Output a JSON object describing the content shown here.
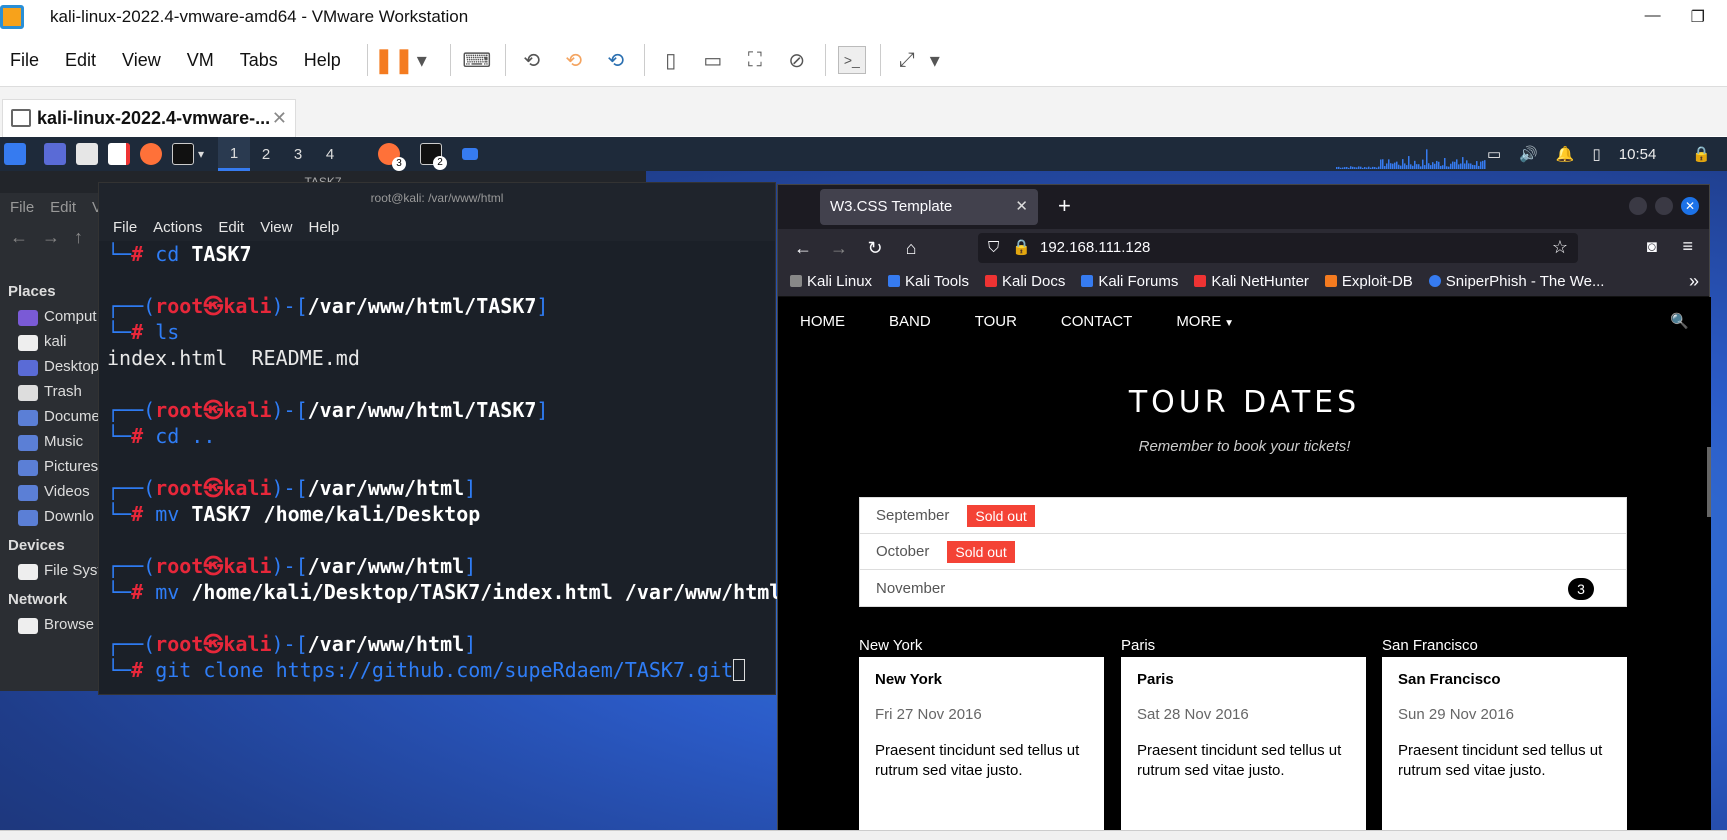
{
  "vmware": {
    "window_title": "kali-linux-2022.4-vmware-amd64 - VMware Workstation",
    "menu": [
      "File",
      "Edit",
      "View",
      "VM",
      "Tabs",
      "Help"
    ],
    "tab_label": "kali-linux-2022.4-vmware-..."
  },
  "panel": {
    "workspaces": [
      "1",
      "2",
      "3",
      "4"
    ],
    "badge_firefox": "3",
    "badge_term": "2",
    "clock": "10:54",
    "graph_color": "#367bf0"
  },
  "filemanager": {
    "title": "TASK7",
    "menu": [
      "File",
      "Edit",
      "V"
    ],
    "places_header": "Places",
    "places": [
      "Comput",
      "kali",
      "Desktop",
      "Trash",
      "Docume",
      "Music",
      "Pictures",
      "Videos",
      "Downlo"
    ],
    "devices_header": "Devices",
    "devices": [
      "File Syst"
    ],
    "network_header": "Network",
    "network": [
      "Browse"
    ]
  },
  "terminal": {
    "title": "root@kali: /var/www/html",
    "menu": [
      "File",
      "Actions",
      "Edit",
      "View",
      "Help"
    ],
    "lines": {
      "l1_cmd": "cd ",
      "l1_arg": "TASK7",
      "p2_path": "/var/www/html/TASK7",
      "l2_cmd": "ls",
      "out_ls": "index.html  README.md",
      "p3_path": "/var/www/html/TASK7",
      "l3_cmd": "cd ..",
      "p4_path": "/var/www/html",
      "l4_cmd": "mv ",
      "l4_arg": "TASK7 /home/kali/Desktop",
      "p5_path": "/var/www/html",
      "l5_cmd": "mv ",
      "l5_arg": "/home/kali/Desktop/TASK7/index.html /var/www/html",
      "p6_path": "/var/www/html",
      "l6_cmd": "git clone https://github.com/supeRdaem/TASK7.git"
    },
    "user": "root",
    "host": "kali"
  },
  "firefox": {
    "tab_title": "W3.CSS Template",
    "url": "192.168.111.128",
    "bookmarks": [
      "Kali Linux",
      "Kali Tools",
      "Kali Docs",
      "Kali Forums",
      "Kali NetHunter",
      "Exploit-DB",
      "SniperPhish - The We..."
    ]
  },
  "page": {
    "nav": [
      "HOME",
      "BAND",
      "TOUR",
      "CONTACT",
      "MORE"
    ],
    "heading": "TOUR DATES",
    "subheading": "Remember to book your tickets!",
    "months": [
      {
        "name": "September",
        "badge": "Sold out"
      },
      {
        "name": "October",
        "badge": "Sold out"
      },
      {
        "name": "November",
        "count": "3"
      }
    ],
    "cities": [
      {
        "label": "New York",
        "name": "New York",
        "date": "Fri 27 Nov 2016",
        "text": "Praesent tincidunt sed tellus ut rutrum sed vitae justo."
      },
      {
        "label": "Paris",
        "name": "Paris",
        "date": "Sat 28 Nov 2016",
        "text": "Praesent tincidunt sed tellus ut rutrum sed vitae justo."
      },
      {
        "label": "San Francisco",
        "name": "San Francisco",
        "date": "Sun 29 Nov 2016",
        "text": "Praesent tincidunt sed tellus ut rutrum sed vitae justo."
      }
    ]
  }
}
